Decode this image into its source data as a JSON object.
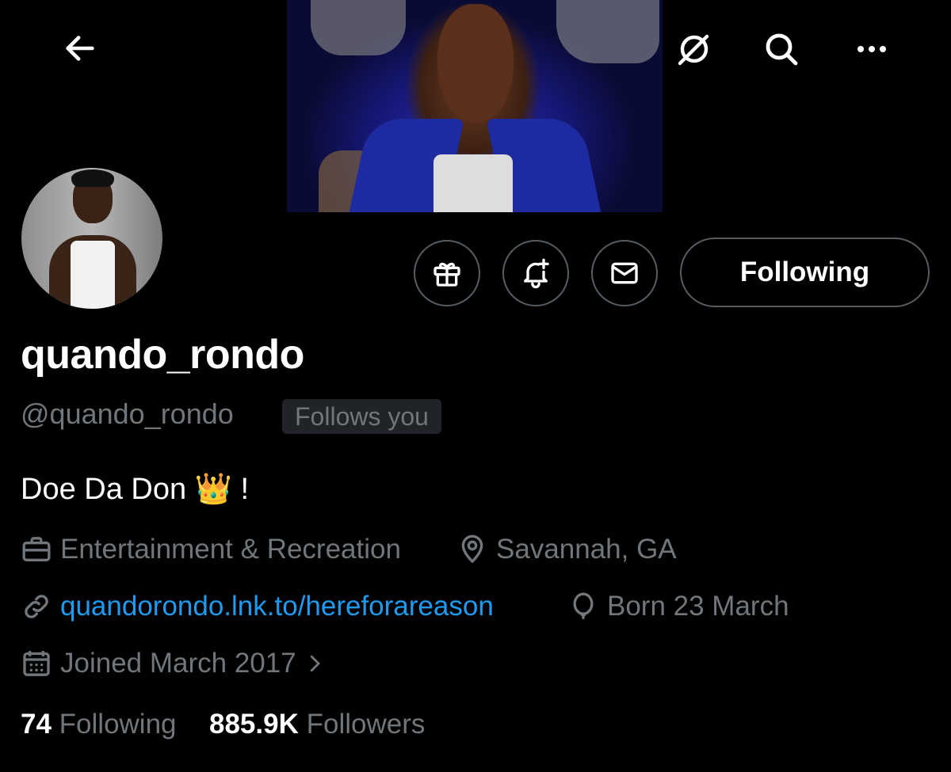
{
  "header": {
    "back_icon": "arrow-left-icon",
    "grok_icon": "grok-icon",
    "search_icon": "search-icon",
    "more_icon": "more-horizontal-icon"
  },
  "actions": {
    "gift_icon": "gift-icon",
    "notify_icon": "bell-plus-icon",
    "message_icon": "mail-icon",
    "following_label": "Following"
  },
  "profile": {
    "display_name": "quando_rondo",
    "handle": "@quando_rondo",
    "follows_you": "Follows you",
    "bio": "Doe Da Don 👑 !",
    "category": "Entertainment & Recreation",
    "location": "Savannah, GA",
    "website": "quandorondo.lnk.to/hereforareason",
    "birthday": "Born 23 March",
    "joined": "Joined March 2017"
  },
  "stats": {
    "following_count": "74",
    "following_label": "Following",
    "followers_count": "885.9K",
    "followers_label": "Followers"
  },
  "colors": {
    "background": "#000000",
    "text_primary": "#ffffff",
    "text_secondary": "#71767b",
    "link": "#1d9bf0",
    "button_border": "#555d63"
  }
}
